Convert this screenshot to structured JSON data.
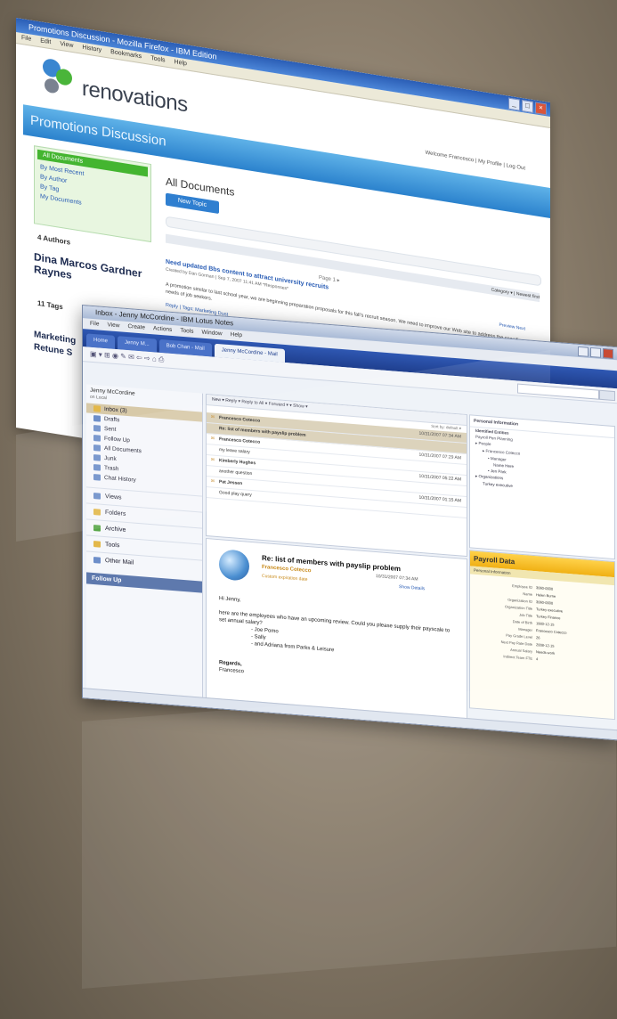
{
  "back_window": {
    "title": "Promotions Discussion - Mozilla Firefox - IBM Edition",
    "menu": [
      "File",
      "Edit",
      "View",
      "History",
      "Bookmarks",
      "Tools",
      "Help"
    ],
    "brand": "renovations",
    "user_links": "Welcome Francesco | My Profile | Log Out",
    "banner": "Promotions Discussion",
    "nav": [
      "All Documents",
      "By Most Recent",
      "By Author",
      "By Tag",
      "My Documents"
    ],
    "authors_label": "4 Authors",
    "authors_names": "Dina Marcos Gardner Raynes",
    "tags_label": "11 Tags",
    "tags_big": "Marketing Retune S",
    "main_heading": "All Documents",
    "new_topic": "New Topic",
    "category_bar": "Category ▾  | Newest first",
    "page_index": "Page 1  ▸",
    "doc_title": "Need updated Bbs content to attract university recruits",
    "doc_meta": "Created by Dan Gorman | Sep 7, 2007 11:41 AM  *Responses*",
    "doc_body": "A promotion similar to last school year, we are beginning preparation proposals for this fall's recruit season. We need to improve our Web site to address the specific needs of job seekers.",
    "doc_reply": "Reply  | Tags: Marketing  Dust",
    "right_links": "Preview  Next"
  },
  "front_window": {
    "title": "Inbox - Jenny McCordine - IBM Lotus Notes",
    "menu": [
      "File",
      "View",
      "Create",
      "Actions",
      "Tools",
      "Window",
      "Help"
    ],
    "tabs": [
      "Home",
      "Jenny M...",
      "Bob Chan - Mail",
      "Jenny McCordine - Mail"
    ],
    "nav_owner": "Jenny McCordine",
    "nav_sub": "on Local",
    "nav_items": [
      "Inbox (3)",
      "Drafts",
      "Sent",
      "Follow Up",
      "All Documents",
      "Junk",
      "Trash",
      "Chat History"
    ],
    "nav_groups": [
      "Views",
      "Folders",
      "Archive",
      "Tools",
      "Other Mail"
    ],
    "follow_up": "Follow Up",
    "list_toolbar": "New ▾   Reply ▾   Reply to All ▾   Forward ▾   ▾   Show ▾",
    "sort_label": "Sort by: default ▾",
    "messages": [
      {
        "name": "Francesco Cotecco",
        "date": "10/31/2007 07:34 AM",
        "subject": "Re: list of members with payslip problem",
        "hl": true
      },
      {
        "name": "Francesco Cotecco",
        "date": "10/31/2007 07:29 AM",
        "subject": "my leave salary"
      },
      {
        "name": "Kimberly Hughes",
        "date": "10/31/2007 05:22 AM",
        "subject": "another question"
      },
      {
        "name": "Pat Jessen",
        "date": "10/31/2007 01:15 AM",
        "subject": "Good play query"
      }
    ],
    "preview": {
      "subject": "Re: list of members with payslip problem",
      "from": "Francesco Cotecco",
      "date": "10/31/2007 07:34 AM",
      "label": "Custom expiration date",
      "details": "Show Details",
      "body": [
        "Hi Jenny,",
        "",
        "here are the employees who have an upcoming review. Could you please supply their payscale to set annual salary?",
        "- Joe Pomo",
        "- Sally",
        "- and Adriana from Parks & Leisure",
        "",
        "Regards,",
        "Francesco"
      ]
    },
    "side": {
      "heading": "Personal Information",
      "sub": "Identified Entities",
      "lines": [
        "Payroll Pen Planning",
        "▸ People",
        "  ▸ Francesco Cotecco",
        "     • Manager",
        "       Name Here",
        "     • Jen Park",
        "▸ Organizations",
        "   Turkey executive"
      ]
    },
    "payroll": {
      "title": "Payroll Data",
      "sub": "Personal Information",
      "fields": [
        {
          "k": "Employee ID",
          "v": "3060-0000"
        },
        {
          "k": "Name",
          "v": "Helen Burne"
        },
        {
          "k": "Organization ID",
          "v": "3060-0000"
        },
        {
          "k": "Organization Title",
          "v": "Turkey executive"
        },
        {
          "k": "Job Title",
          "v": "Turkey Finance"
        },
        {
          "k": "Date of Birth",
          "v": "1983-12-15"
        },
        {
          "k": "Manager",
          "v": "Francesco Cotecco"
        },
        {
          "k": "Pay Grade Level",
          "v": "26"
        },
        {
          "k": "Next Pay Rate Date",
          "v": "2008-12-15"
        },
        {
          "k": "Annual Salary",
          "v": "Needs work"
        },
        {
          "k": "Indirect Team FTE",
          "v": "4"
        }
      ]
    }
  }
}
